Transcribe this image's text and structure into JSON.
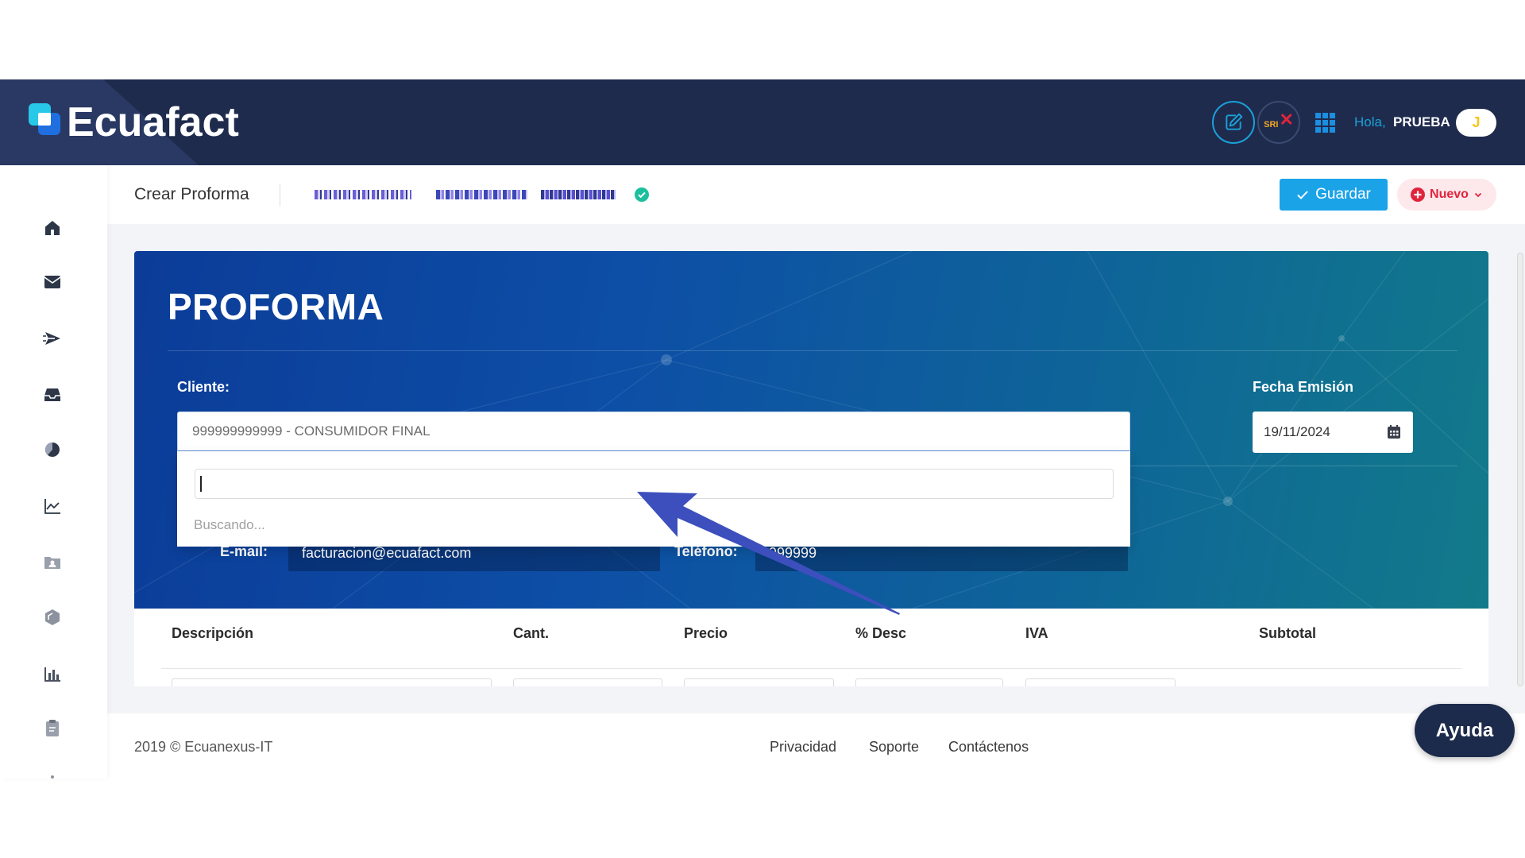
{
  "header": {
    "logo_text": "Ecuafact",
    "sri_label": "SRI",
    "greeting": "Hola,",
    "user_name": "PRUEBA",
    "avatar_initial": "J",
    "icons": [
      "edit-document-icon",
      "sri-status-icon",
      "apps-grid-icon"
    ]
  },
  "sidebar": {
    "items": [
      {
        "icon": "home-icon"
      },
      {
        "icon": "mail-icon"
      },
      {
        "icon": "send-icon"
      },
      {
        "icon": "inbox-icon"
      },
      {
        "icon": "pie-chart-icon"
      },
      {
        "icon": "line-chart-icon"
      },
      {
        "icon": "contacts-folder-icon"
      },
      {
        "icon": "box-icon"
      },
      {
        "icon": "bar-chart-icon"
      },
      {
        "icon": "clipboard-icon"
      }
    ]
  },
  "subheader": {
    "title": "Crear Proforma",
    "save_label": "Guardar",
    "new_label": "Nuevo"
  },
  "form": {
    "title": "PROFORMA",
    "client_label": "Cliente:",
    "client_value": "999999999999 - CONSUMIDOR FINAL",
    "search_value": "",
    "search_status": "Buscando...",
    "date_label": "Fecha Emisión",
    "date_value": "19/11/2024",
    "email_label": "E-mail:",
    "email_value": "facturacion@ecuafact.com",
    "phone_label": "Teléfono:",
    "phone_value": "999999"
  },
  "table": {
    "columns": [
      "Descripción",
      "Cant.",
      "Precio",
      "% Desc",
      "IVA",
      "Subtotal"
    ]
  },
  "footer": {
    "copyright": "2019 © Ecuanexus-IT",
    "links": [
      "Privacidad",
      "Soporte",
      "Contáctenos"
    ]
  },
  "help_button": {
    "label": "Ayuda"
  },
  "colors": {
    "header_bg": "#1f2b4d",
    "accent": "#1ba3e8",
    "danger": "#e0243c",
    "success": "#1cbf9e",
    "card_gradient_start": "#0b3c98",
    "card_gradient_end": "#127a8a",
    "annotation": "#3d4fbd"
  }
}
